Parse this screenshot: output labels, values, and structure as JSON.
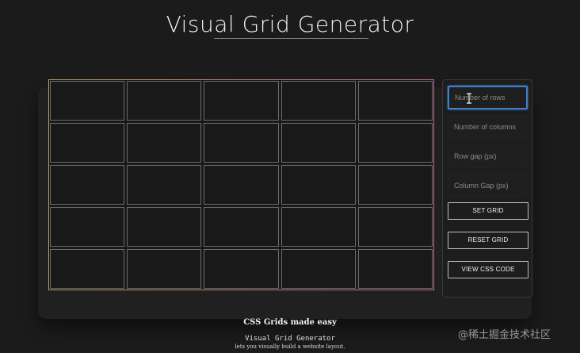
{
  "header": {
    "title": "Visual Grid Generator"
  },
  "grid": {
    "rows": 5,
    "columns": 5
  },
  "controls": {
    "rows_placeholder": "Number of rows",
    "columns_placeholder": "Number of columns",
    "row_gap_placeholder": "Row gap (px)",
    "column_gap_placeholder": "Column Gap (px)",
    "set_label": "SET GRID",
    "reset_label": "RESET GRID",
    "view_css_label": "VIEW CSS CODE"
  },
  "footer": {
    "heading": "CSS Grids made easy",
    "title": "Visual Grid Generator",
    "subtitle": "lets you visually build a website layout."
  },
  "watermark": "@稀土掘金技术社区",
  "colors": {
    "background": "#1b1b1b",
    "focus_border": "#3f7fcf",
    "grid_border_start": "#b7a16c",
    "grid_border_end": "#c76b80"
  },
  "icons": {
    "cursor": "text-cursor-icon"
  }
}
